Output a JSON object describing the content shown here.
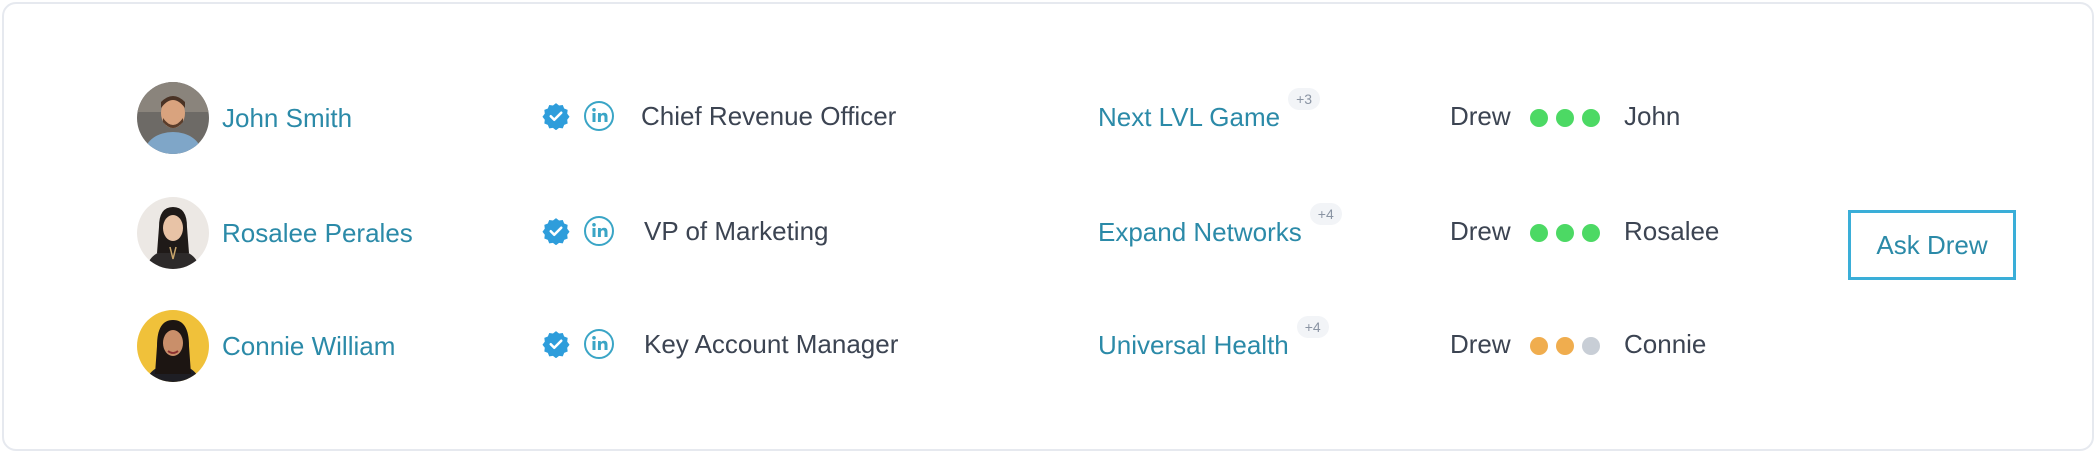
{
  "colors": {
    "link": "#2b8aa8",
    "text": "#3c4452",
    "verified": "#2e9ddb",
    "linkedin": "#3aa5c6",
    "dot_green": "#4cd964",
    "dot_orange": "#f0ad4e",
    "dot_gray": "#c8ced6",
    "button_border": "#3aaed8"
  },
  "icons": {
    "verified": "verified-badge-icon",
    "linkedin": "linkedin-icon"
  },
  "rows": [
    {
      "name": "John Smith",
      "title": "Chief Revenue Officer",
      "company": "Next LVL Game",
      "more": "+3",
      "from": "Drew",
      "to": "John",
      "connection_strength": [
        "green",
        "green",
        "green"
      ]
    },
    {
      "name": "Rosalee Perales",
      "title": "VP of Marketing",
      "company": "Expand Networks",
      "more": "+4",
      "from": "Drew",
      "to": "Rosalee",
      "connection_strength": [
        "green",
        "green",
        "green"
      ]
    },
    {
      "name": "Connie William",
      "title": "Key Account Manager",
      "company": "Universal Health",
      "more": "+4",
      "from": "Drew",
      "to": "Connie",
      "connection_strength": [
        "orange",
        "orange",
        "gray"
      ]
    }
  ],
  "ask_button": {
    "label": "Ask Drew"
  }
}
